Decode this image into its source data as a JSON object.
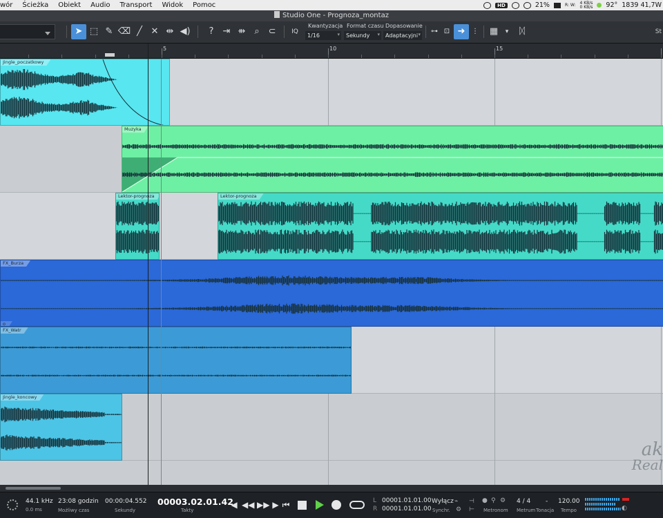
{
  "menubar": {
    "items": [
      "wór",
      "Ścieżka",
      "Obiekt",
      "Audio",
      "Transport",
      "Widok",
      "Pomoc"
    ],
    "status_battery": "21%",
    "status_net_up": "4 KB/s",
    "status_net_down": "0 KB/s",
    "status_net_labels": "R: W:",
    "status_temp": "92°",
    "status_right": "1839 41,7W",
    "hd_label": "HD"
  },
  "window": {
    "title": "Studio One - Prognoza_montaz"
  },
  "toolbar": {
    "quant_icon_label": "IQ",
    "kwantyzacja_label": "Kwantyzacja",
    "kwantyzacja_value": "1/16",
    "format_label": "Format czasu",
    "format_value": "Sekundy",
    "dopasowanie_label": "Dopasowanie",
    "dopasowanie_value": "Adaptacyjni",
    "right_label": "St"
  },
  "ruler": {
    "labels": [
      "5",
      "10",
      "15"
    ]
  },
  "events": [
    {
      "label": "Jingle_poczatkowy"
    },
    {
      "label": "Muzyka"
    },
    {
      "label": "Lektor-prognoza"
    },
    {
      "label": "Lektor-prognoza"
    },
    {
      "label": "FX_Burza"
    },
    {
      "label": "o"
    },
    {
      "label": "FX_Watr"
    },
    {
      "label": "Jingle_koncowy"
    }
  ],
  "watermark": {
    "line1": "ak",
    "line2": "Real"
  },
  "transport": {
    "sample_rate": "44.1 kHz",
    "latency": "0.0 ms",
    "record_time": "23:08 godzin",
    "record_time_label": "Możliwy czas",
    "seconds_value": "00:00:04.552",
    "seconds_label": "Sekundy",
    "bars_value": "00003.02.01.42",
    "bars_label": "Takty",
    "loop_l_label": "L",
    "loop_l_value": "00001.01.01.00",
    "loop_r_label": "R",
    "loop_r_value": "00001.01.01.00",
    "sync_value": "Wyłącz",
    "sync_label": "Synchr.",
    "metronome_label": "Metronom",
    "time_sig": "4 / 4",
    "time_sig_label": "Metrum",
    "key_value": "-",
    "key_label": "Tonacja",
    "tempo_value": "120.00",
    "tempo_label": "Tempo"
  },
  "colors": {
    "jingle": "#58e6f0",
    "muzyka": "#6ef0a4",
    "lektor": "#45dac8",
    "burza": "#2b68d8",
    "watr": "#3c9bd6",
    "jingle_end": "#4cc4e6",
    "waveform_dark": "#17323a"
  }
}
